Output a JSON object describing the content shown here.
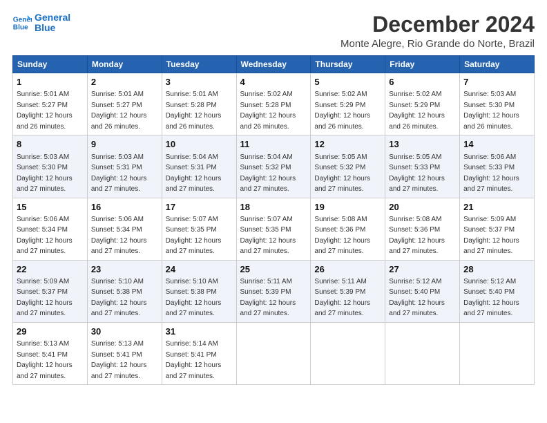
{
  "logo": {
    "line1": "General",
    "line2": "Blue"
  },
  "title": "December 2024",
  "subtitle": "Monte Alegre, Rio Grande do Norte, Brazil",
  "headers": [
    "Sunday",
    "Monday",
    "Tuesday",
    "Wednesday",
    "Thursday",
    "Friday",
    "Saturday"
  ],
  "weeks": [
    [
      {
        "day": "1",
        "rise": "5:01 AM",
        "set": "5:27 PM",
        "daylight": "12 hours and 26 minutes."
      },
      {
        "day": "2",
        "rise": "5:01 AM",
        "set": "5:27 PM",
        "daylight": "12 hours and 26 minutes."
      },
      {
        "day": "3",
        "rise": "5:01 AM",
        "set": "5:28 PM",
        "daylight": "12 hours and 26 minutes."
      },
      {
        "day": "4",
        "rise": "5:02 AM",
        "set": "5:28 PM",
        "daylight": "12 hours and 26 minutes."
      },
      {
        "day": "5",
        "rise": "5:02 AM",
        "set": "5:29 PM",
        "daylight": "12 hours and 26 minutes."
      },
      {
        "day": "6",
        "rise": "5:02 AM",
        "set": "5:29 PM",
        "daylight": "12 hours and 26 minutes."
      },
      {
        "day": "7",
        "rise": "5:03 AM",
        "set": "5:30 PM",
        "daylight": "12 hours and 26 minutes."
      }
    ],
    [
      {
        "day": "8",
        "rise": "5:03 AM",
        "set": "5:30 PM",
        "daylight": "12 hours and 27 minutes."
      },
      {
        "day": "9",
        "rise": "5:03 AM",
        "set": "5:31 PM",
        "daylight": "12 hours and 27 minutes."
      },
      {
        "day": "10",
        "rise": "5:04 AM",
        "set": "5:31 PM",
        "daylight": "12 hours and 27 minutes."
      },
      {
        "day": "11",
        "rise": "5:04 AM",
        "set": "5:32 PM",
        "daylight": "12 hours and 27 minutes."
      },
      {
        "day": "12",
        "rise": "5:05 AM",
        "set": "5:32 PM",
        "daylight": "12 hours and 27 minutes."
      },
      {
        "day": "13",
        "rise": "5:05 AM",
        "set": "5:33 PM",
        "daylight": "12 hours and 27 minutes."
      },
      {
        "day": "14",
        "rise": "5:06 AM",
        "set": "5:33 PM",
        "daylight": "12 hours and 27 minutes."
      }
    ],
    [
      {
        "day": "15",
        "rise": "5:06 AM",
        "set": "5:34 PM",
        "daylight": "12 hours and 27 minutes."
      },
      {
        "day": "16",
        "rise": "5:06 AM",
        "set": "5:34 PM",
        "daylight": "12 hours and 27 minutes."
      },
      {
        "day": "17",
        "rise": "5:07 AM",
        "set": "5:35 PM",
        "daylight": "12 hours and 27 minutes."
      },
      {
        "day": "18",
        "rise": "5:07 AM",
        "set": "5:35 PM",
        "daylight": "12 hours and 27 minutes."
      },
      {
        "day": "19",
        "rise": "5:08 AM",
        "set": "5:36 PM",
        "daylight": "12 hours and 27 minutes."
      },
      {
        "day": "20",
        "rise": "5:08 AM",
        "set": "5:36 PM",
        "daylight": "12 hours and 27 minutes."
      },
      {
        "day": "21",
        "rise": "5:09 AM",
        "set": "5:37 PM",
        "daylight": "12 hours and 27 minutes."
      }
    ],
    [
      {
        "day": "22",
        "rise": "5:09 AM",
        "set": "5:37 PM",
        "daylight": "12 hours and 27 minutes."
      },
      {
        "day": "23",
        "rise": "5:10 AM",
        "set": "5:38 PM",
        "daylight": "12 hours and 27 minutes."
      },
      {
        "day": "24",
        "rise": "5:10 AM",
        "set": "5:38 PM",
        "daylight": "12 hours and 27 minutes."
      },
      {
        "day": "25",
        "rise": "5:11 AM",
        "set": "5:39 PM",
        "daylight": "12 hours and 27 minutes."
      },
      {
        "day": "26",
        "rise": "5:11 AM",
        "set": "5:39 PM",
        "daylight": "12 hours and 27 minutes."
      },
      {
        "day": "27",
        "rise": "5:12 AM",
        "set": "5:40 PM",
        "daylight": "12 hours and 27 minutes."
      },
      {
        "day": "28",
        "rise": "5:12 AM",
        "set": "5:40 PM",
        "daylight": "12 hours and 27 minutes."
      }
    ],
    [
      {
        "day": "29",
        "rise": "5:13 AM",
        "set": "5:41 PM",
        "daylight": "12 hours and 27 minutes."
      },
      {
        "day": "30",
        "rise": "5:13 AM",
        "set": "5:41 PM",
        "daylight": "12 hours and 27 minutes."
      },
      {
        "day": "31",
        "rise": "5:14 AM",
        "set": "5:41 PM",
        "daylight": "12 hours and 27 minutes."
      },
      null,
      null,
      null,
      null
    ]
  ],
  "labels": {
    "sunrise": "Sunrise:",
    "sunset": "Sunset:",
    "daylight": "Daylight:"
  }
}
